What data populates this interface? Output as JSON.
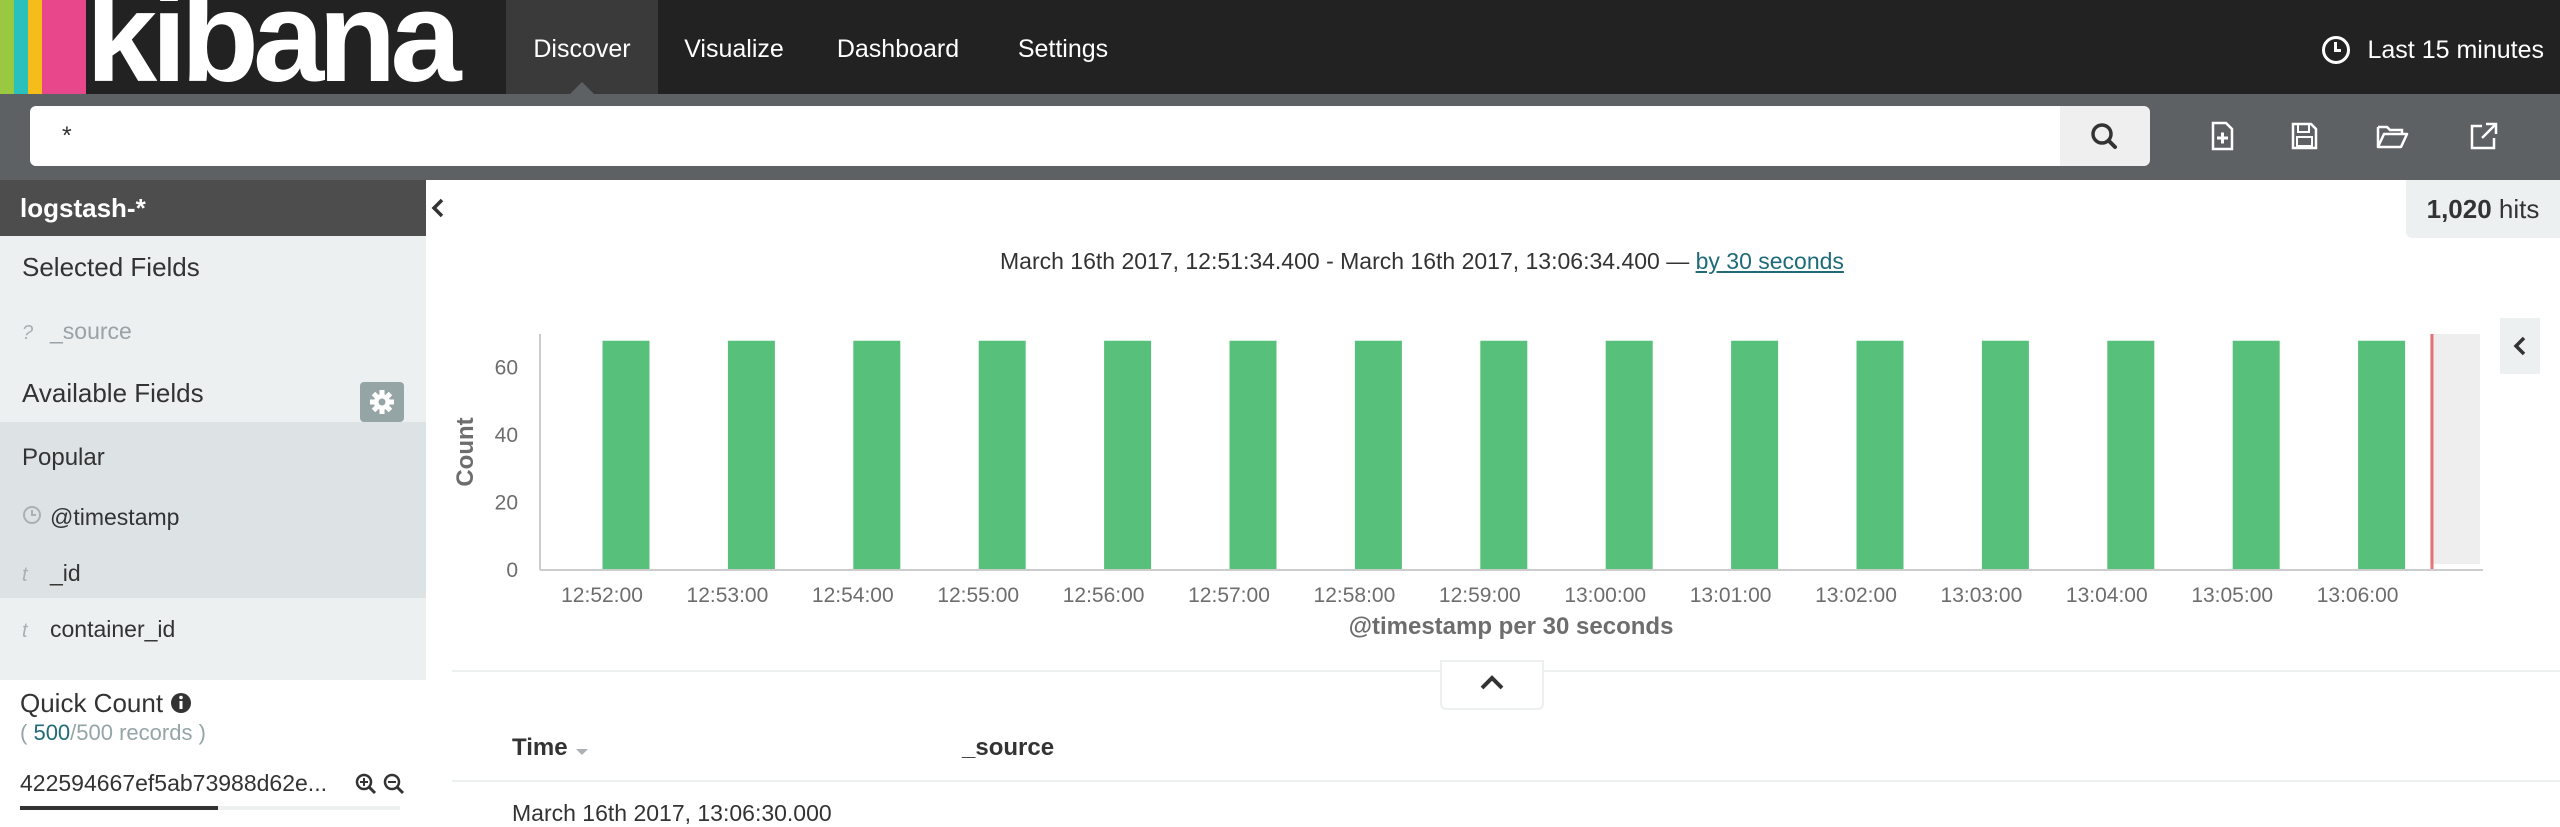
{
  "app": {
    "logo_text": "kibana",
    "logo_colors": [
      "#9ac941",
      "#2ac1bc",
      "#f4bd19",
      "#e8478b",
      "#1a1a1a"
    ]
  },
  "nav": {
    "items": [
      {
        "label": "Discover",
        "active": true
      },
      {
        "label": "Visualize",
        "active": false
      },
      {
        "label": "Dashboard",
        "active": false
      },
      {
        "label": "Settings",
        "active": false
      }
    ],
    "timepicker_label": "Last 15 minutes"
  },
  "search": {
    "query": "*"
  },
  "sidebar": {
    "index_pattern": "logstash-*",
    "selected_fields_heading": "Selected Fields",
    "selected_fields": [
      {
        "type_icon": "?",
        "name": "_source"
      }
    ],
    "available_fields_heading": "Available Fields",
    "popular_heading": "Popular",
    "popular_fields": [
      {
        "type_icon": "clock",
        "name": "@timestamp"
      },
      {
        "type_icon": "t",
        "name": "_id"
      },
      {
        "type_icon": "t",
        "name": "container_id"
      }
    ],
    "quick_count_heading": "Quick Count",
    "quick_count_open": "(",
    "quick_count_n": "500",
    "quick_count_rest": "/500 records )",
    "quick_count_value": "422594667ef5ab73988d62e..."
  },
  "main": {
    "hits_count": "1,020",
    "hits_label": "hits",
    "range_text": "March 16th 2017, 12:51:34.400 - March 16th 2017, 13:06:34.400 —",
    "interval_link": "by 30 seconds",
    "table_headers": {
      "time": "Time",
      "source": "_source"
    },
    "first_row_partial": "March 16th 2017, 13:06:30.000"
  },
  "chart_data": {
    "type": "bar",
    "title": "",
    "xlabel": "@timestamp per 30 seconds",
    "ylabel": "Count",
    "ylim": [
      0,
      70
    ],
    "yticks": [
      0,
      20,
      40,
      60
    ],
    "categories": [
      "12:52:00",
      "12:53:00",
      "12:54:00",
      "12:55:00",
      "12:56:00",
      "12:57:00",
      "12:58:00",
      "12:59:00",
      "13:00:00",
      "13:01:00",
      "13:02:00",
      "13:03:00",
      "13:04:00",
      "13:05:00",
      "13:06:00"
    ],
    "values": [
      68,
      68,
      68,
      68,
      68,
      68,
      68,
      68,
      68,
      68,
      68,
      68,
      68,
      68,
      68
    ],
    "bar_color": "#57c17b",
    "grid": false
  }
}
